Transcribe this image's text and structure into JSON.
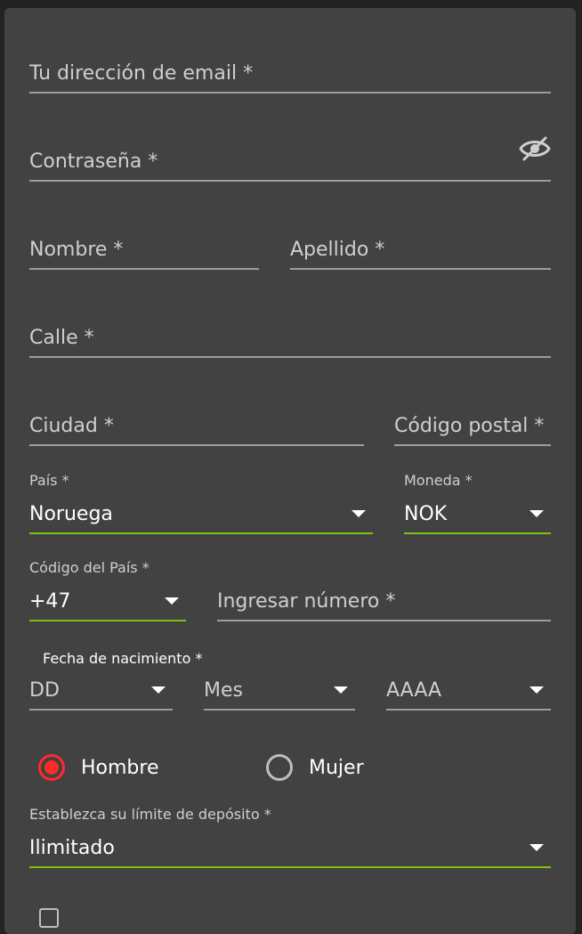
{
  "email": {
    "placeholder": "Tu dirección de email *"
  },
  "password": {
    "placeholder": "Contraseña *",
    "icon": "eye-off-icon"
  },
  "first_name": {
    "placeholder": "Nombre *"
  },
  "last_name": {
    "placeholder": "Apellido *"
  },
  "street": {
    "placeholder": "Calle *"
  },
  "city": {
    "placeholder": "Ciudad *"
  },
  "postal_code": {
    "placeholder": "Código postal *"
  },
  "country": {
    "label": "País *",
    "value": "Noruega"
  },
  "currency": {
    "label": "Moneda *",
    "value": "NOK"
  },
  "country_code": {
    "label": "Código del País *",
    "value": "+47"
  },
  "phone": {
    "placeholder": "Ingresar número *"
  },
  "birthdate": {
    "label": "Fecha de nacimiento *",
    "day": "DD",
    "month": "Mes",
    "year": "AAAA"
  },
  "gender": {
    "selected": "Hombre",
    "options": [
      "Hombre",
      "Mujer"
    ]
  },
  "deposit_limit": {
    "label": "Establezca su límite de depósito *",
    "value": "Ilimitado"
  },
  "colors": {
    "accent_green": "#7cc114",
    "radio_red": "#ff2a2a",
    "card_bg": "#424242"
  }
}
